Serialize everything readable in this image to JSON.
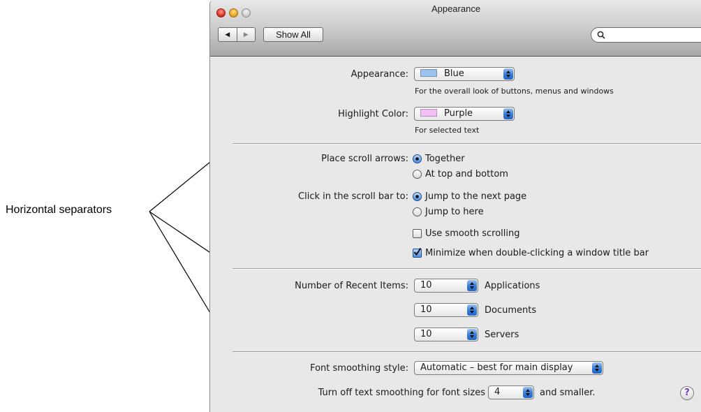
{
  "annotation": {
    "label": "Horizontal separators"
  },
  "window": {
    "title": "Appearance"
  },
  "toolbar": {
    "back_icon": "left-arrow-icon",
    "forward_icon": "right-arrow-icon",
    "show_all_label": "Show All",
    "search": {
      "value": "",
      "icon": "search-icon"
    }
  },
  "appearance": {
    "label": "Appearance:",
    "value": "Blue",
    "swatch_color": "#9cc2f0",
    "note": "For the overall look of buttons, menus and windows"
  },
  "highlight": {
    "label": "Highlight Color:",
    "value": "Purple",
    "swatch_color": "#f4c0f6",
    "note": "For selected text"
  },
  "scroll_arrows": {
    "label": "Place scroll arrows:",
    "options": [
      {
        "label": "Together",
        "selected": true
      },
      {
        "label": "At top and bottom",
        "selected": false
      }
    ]
  },
  "scroll_click": {
    "label": "Click in the scroll bar to:",
    "options": [
      {
        "label": "Jump to the next page",
        "selected": true
      },
      {
        "label": "Jump to here",
        "selected": false
      }
    ]
  },
  "checkboxes": [
    {
      "label": "Use smooth scrolling",
      "checked": false
    },
    {
      "label": "Minimize when double-clicking a window title bar",
      "checked": true
    }
  ],
  "recent_items": {
    "label": "Number of Recent Items:",
    "rows": [
      {
        "value": "10",
        "label": "Applications"
      },
      {
        "value": "10",
        "label": "Documents"
      },
      {
        "value": "10",
        "label": "Servers"
      }
    ]
  },
  "font_smoothing": {
    "label": "Font smoothing style:",
    "value": "Automatic – best for main display"
  },
  "text_smoothing": {
    "label_before": "Turn off text smoothing for font sizes",
    "value": "4",
    "label_after": "and smaller."
  },
  "help": {
    "label": "?"
  },
  "colors": {
    "accent": "#3a7fd9",
    "separator": "#9d9d9d",
    "window_bg": "#e8e8e8"
  }
}
